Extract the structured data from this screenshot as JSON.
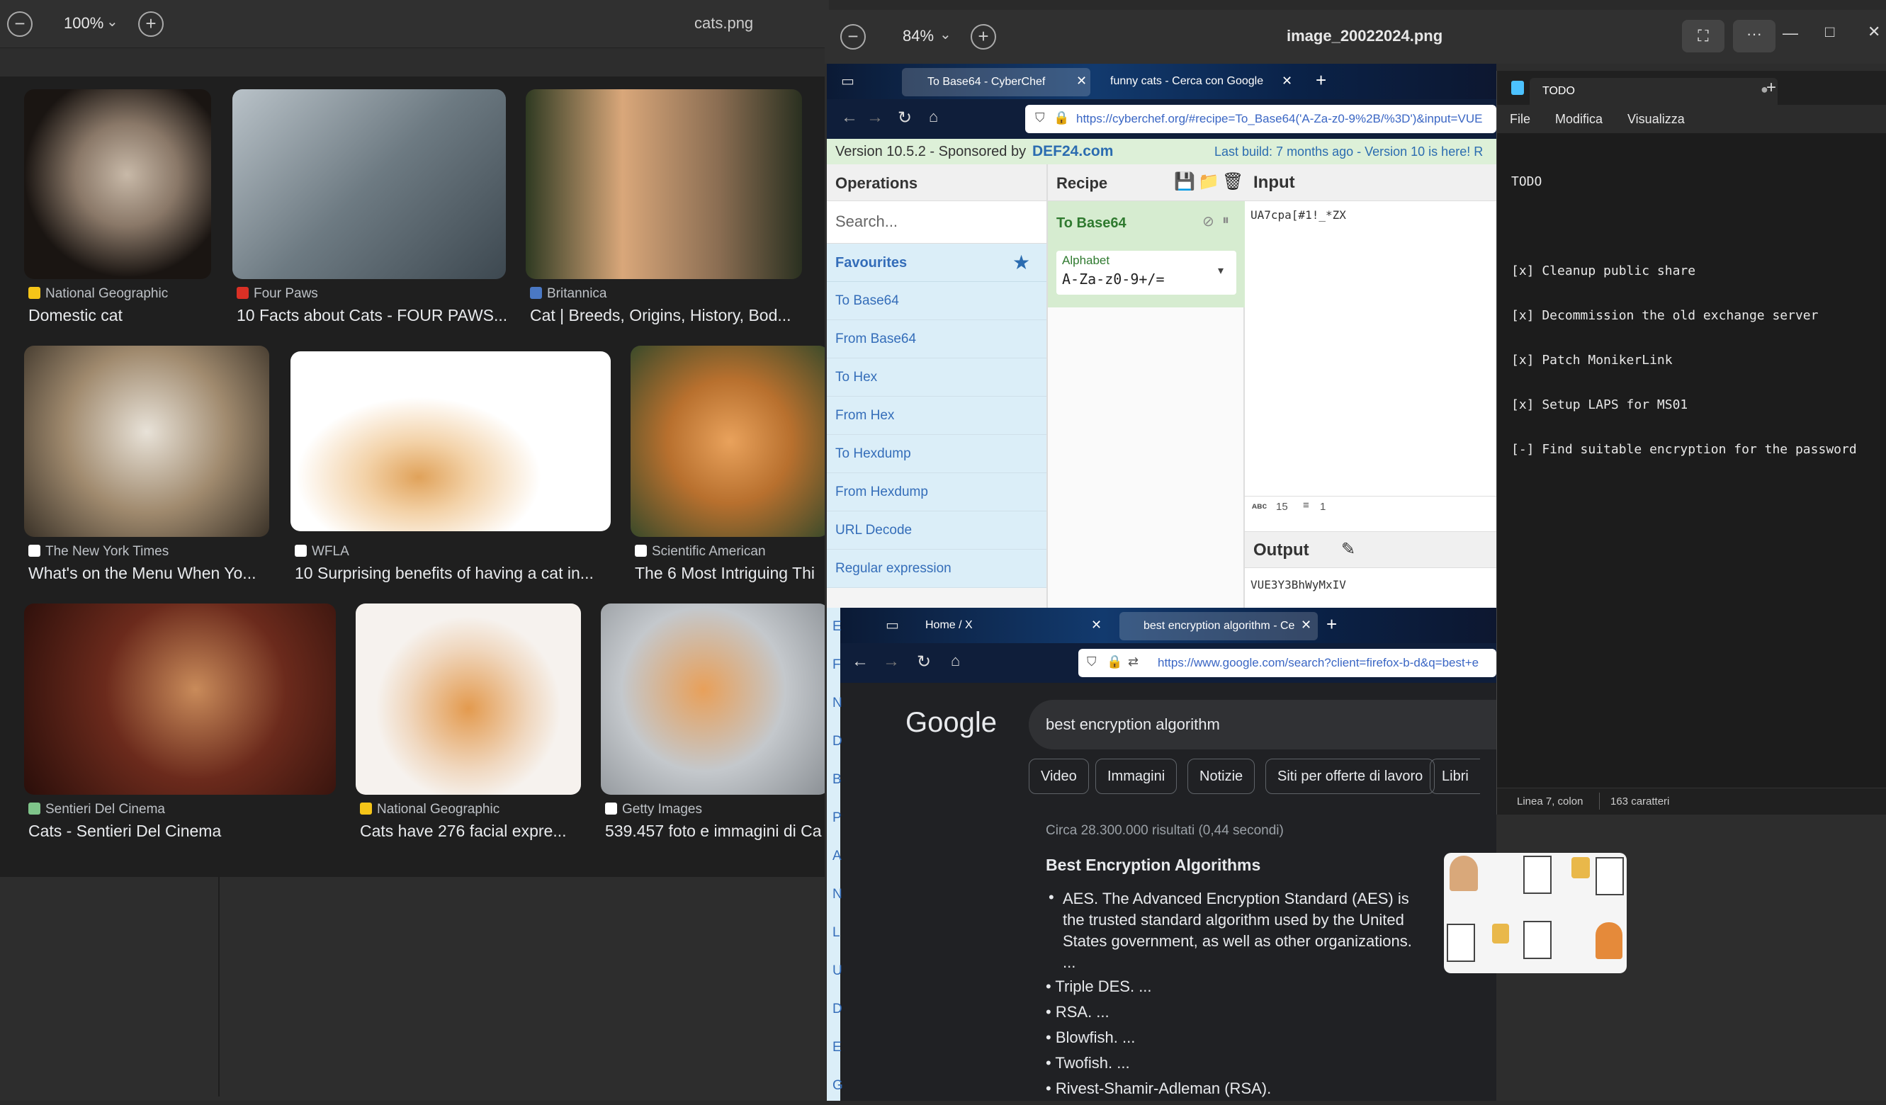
{
  "viewer1": {
    "zoom": "100%",
    "filename": "cats.png",
    "results": [
      {
        "source": "National Geographic",
        "title": "Domestic cat",
        "fav": "#f5c518"
      },
      {
        "source": "Four Paws",
        "title": "10 Facts about Cats - FOUR PAWS...",
        "fav": "#d93025"
      },
      {
        "source": "Britannica",
        "title": "Cat | Breeds, Origins, History, Bod...",
        "fav": "#4a78c4"
      },
      {
        "source": "The New York Times",
        "title": "What's on the Menu When Yo...",
        "fav": "#ffffff"
      },
      {
        "source": "WFLA",
        "title": "10 Surprising benefits of having a cat in...",
        "fav": "#ffffff"
      },
      {
        "source": "Scientific American",
        "title": "The 6 Most Intriguing Thi",
        "fav": "#ffffff"
      },
      {
        "source": "Sentieri Del Cinema",
        "title": "Cats - Sentieri Del Cinema",
        "fav": "#7fc48a"
      },
      {
        "source": "National Geographic",
        "title": "Cats have 276 facial expre...",
        "fav": "#f5c518"
      },
      {
        "source": "Getty Images",
        "title": "539.457 foto e immagini di Ca",
        "fav": "#ffffff"
      }
    ]
  },
  "viewer2": {
    "zoom": "84%",
    "filename": "image_20022024.png"
  },
  "cyberchef": {
    "tabs": [
      "To Base64 - CyberChef",
      "funny cats - Cerca con Google"
    ],
    "url": "https://cyberchef.org/#recipe=To_Base64('A-Za-z0-9%2B/%3D')&input=VUE",
    "version": "Version 10.5.2 - Sponsored by",
    "sponsor": "DEF24.com",
    "build": "Last build: 7 months ago - Version 10 is here! R",
    "operations_title": "Operations",
    "search_placeholder": "Search...",
    "favourites": "Favourites",
    "ops": [
      "To Base64",
      "From Base64",
      "To Hex",
      "From Hex",
      "To Hexdump",
      "From Hexdump",
      "URL Decode",
      "Regular expression"
    ],
    "recipe_title": "Recipe",
    "recipe_op": "To Base64",
    "alphabet_label": "Alphabet",
    "alphabet_value": "A-Za-z0-9+/=",
    "input_title": "Input",
    "input_text": "UA7cpa[#1!_*ZX",
    "input_stats_chars": "15",
    "input_stats_lines": "1",
    "output_title": "Output",
    "output_text": "VUE3Y3BhWyMxIV"
  },
  "google": {
    "tabs": [
      "Home / X",
      "best encryption algorithm - Ce"
    ],
    "url": "https://www.google.com/search?client=firefox-b-d&q=best+e",
    "logo": "Google",
    "query": "best encryption algorithm",
    "chips": [
      "Video",
      "Immagini",
      "Notizie",
      "Siti per offerte di lavoro",
      "Libri"
    ],
    "stats": "Circa 28.300.000 risultati (0,44 secondi)",
    "heading": "Best Encryption Algorithms",
    "aes_lines": [
      "AES. The Advanced Encryption Standard (AES) is",
      "the trusted standard algorithm used by the United",
      "States government, as well as other organizations.",
      "..."
    ],
    "bullets": [
      "Triple DES. ...",
      "RSA. ...",
      "Blowfish. ...",
      "Twofish. ...",
      "Rivest-Shamir-Adleman (RSA)."
    ],
    "sidebar_letters": [
      "E",
      "F",
      "N",
      "D",
      "B",
      "P",
      "A",
      "N",
      "L",
      "U",
      "D",
      "E",
      "G"
    ]
  },
  "notepad": {
    "tab": "TODO",
    "menu": [
      "File",
      "Modifica",
      "Visualizza"
    ],
    "lines": [
      "TODO",
      "",
      "[x] Cleanup public share",
      "[x] Decommission the old exchange server",
      "[x] Patch MonikerLink",
      "[x] Setup LAPS for MS01",
      "[-] Find suitable encryption for the password"
    ],
    "status_pos": "Linea 7, colon",
    "status_chars": "163 caratteri"
  },
  "window_controls": [
    "—",
    "□",
    "✕"
  ]
}
